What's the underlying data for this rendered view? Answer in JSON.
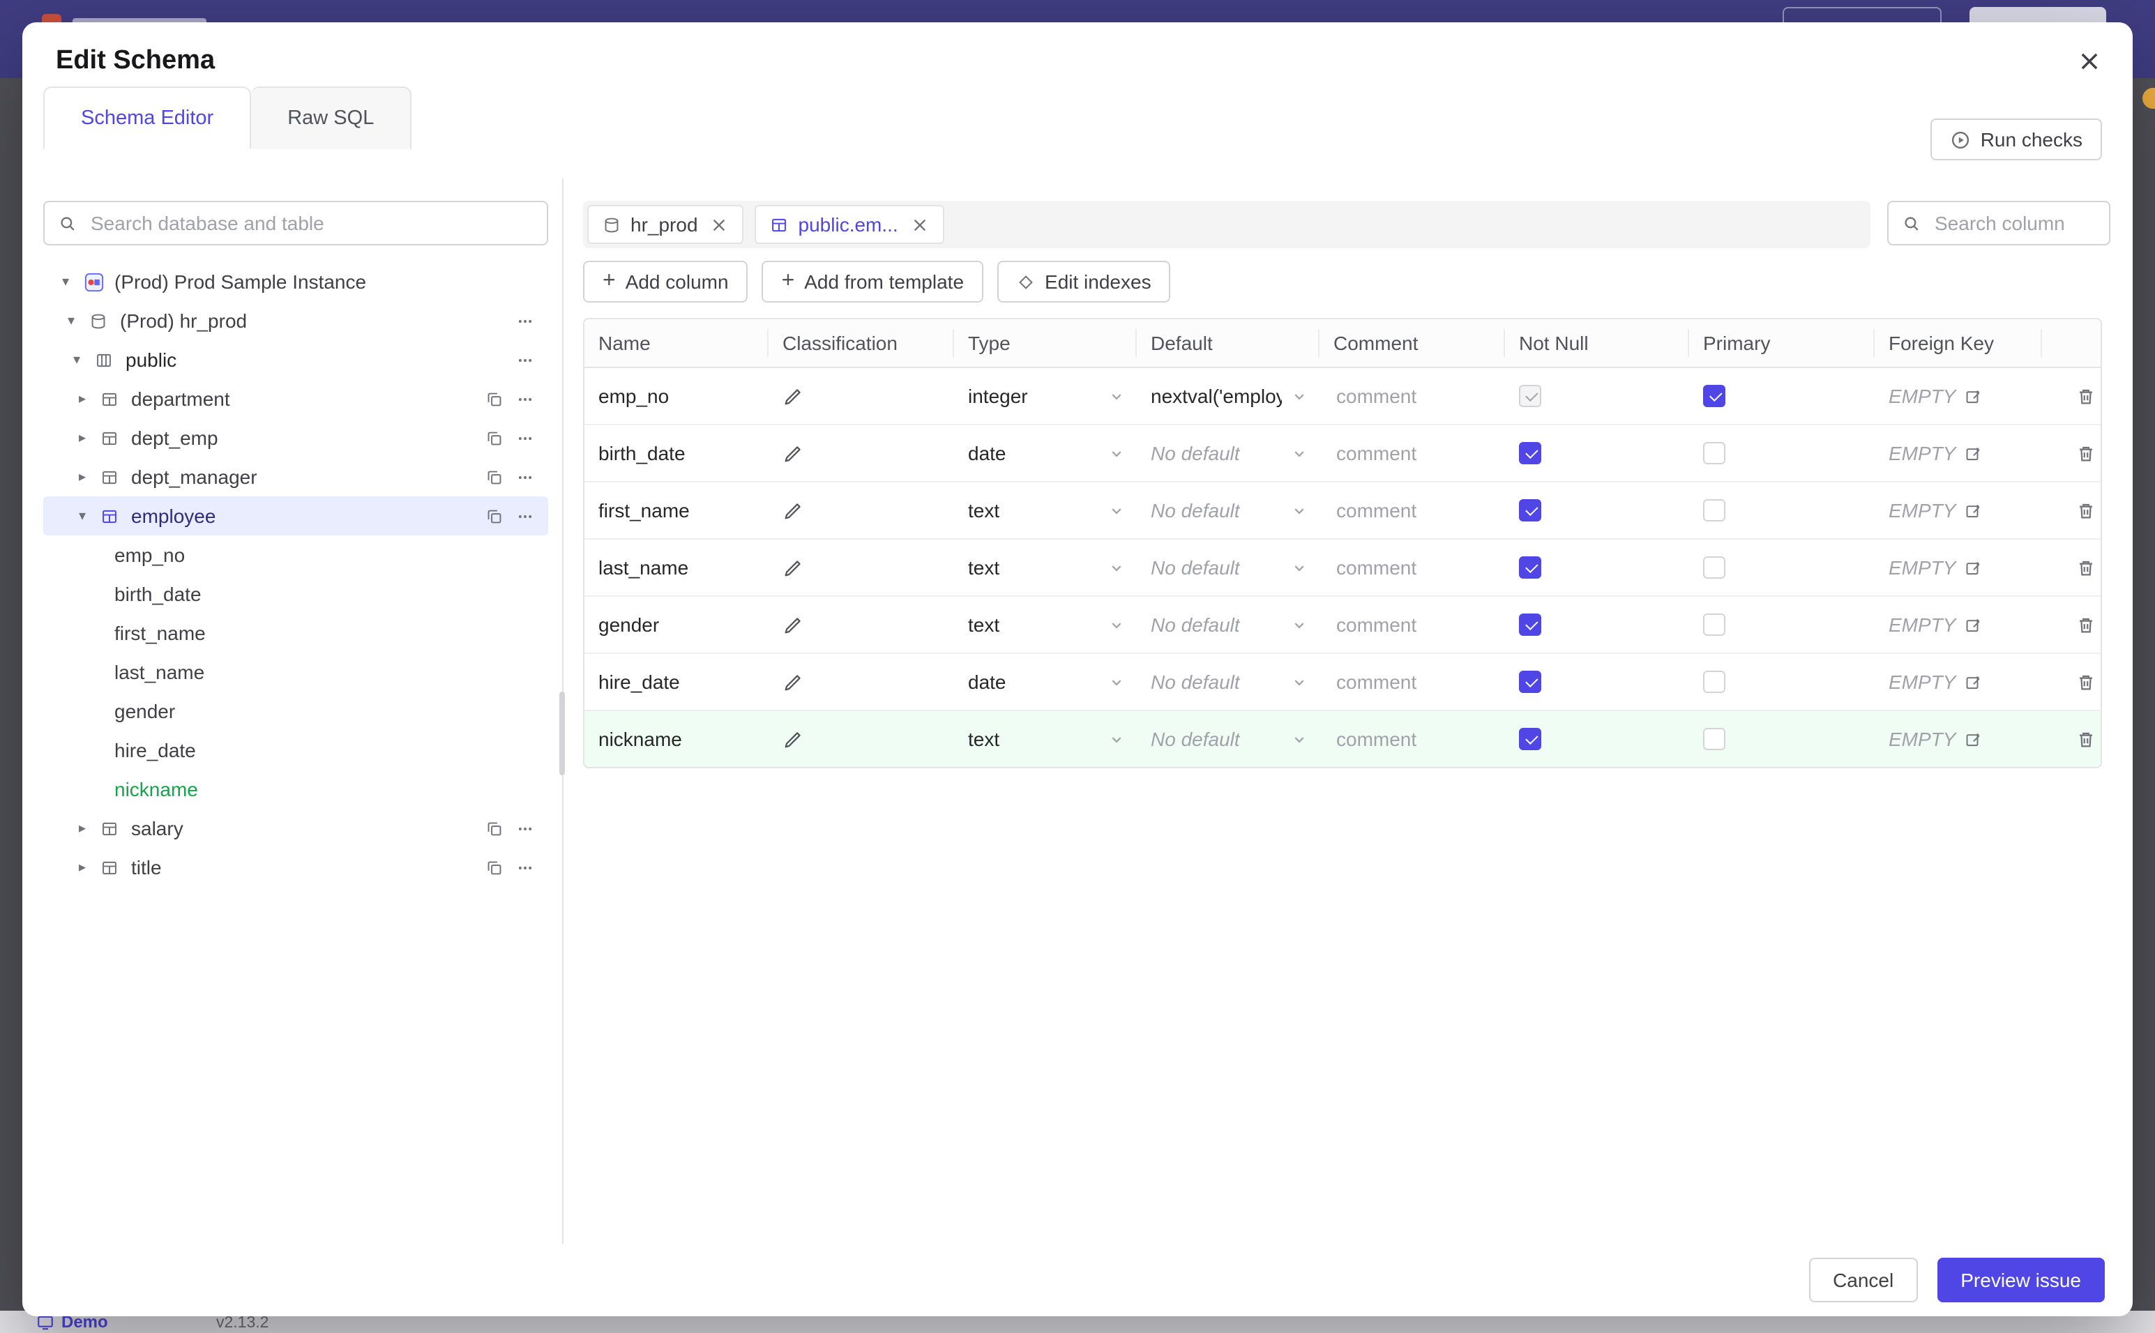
{
  "backdrop": {
    "demo_label": "Demo",
    "version": "v2.13.2"
  },
  "modal": {
    "title": "Edit Schema",
    "tabs": [
      {
        "label": "Schema Editor"
      },
      {
        "label": "Raw SQL"
      }
    ],
    "run_checks_label": "Run checks",
    "footer": {
      "cancel": "Cancel",
      "primary": "Preview issue"
    }
  },
  "sidebar": {
    "search_placeholder": "Search database and table",
    "tree": [
      {
        "label": "(Prod) Prod Sample Instance",
        "type": "instance",
        "expanded": true
      },
      {
        "label": "(Prod) hr_prod",
        "type": "database",
        "expanded": true
      },
      {
        "label": "public",
        "type": "schema",
        "expanded": true
      },
      {
        "label": "department",
        "type": "table",
        "expanded": false
      },
      {
        "label": "dept_emp",
        "type": "table",
        "expanded": false
      },
      {
        "label": "dept_manager",
        "type": "table",
        "expanded": false
      },
      {
        "label": "employee",
        "type": "table",
        "expanded": true,
        "selected": true
      },
      {
        "label": "emp_no",
        "type": "column"
      },
      {
        "label": "birth_date",
        "type": "column"
      },
      {
        "label": "first_name",
        "type": "column"
      },
      {
        "label": "last_name",
        "type": "column"
      },
      {
        "label": "gender",
        "type": "column"
      },
      {
        "label": "hire_date",
        "type": "column"
      },
      {
        "label": "nickname",
        "type": "column",
        "new": true
      },
      {
        "label": "salary",
        "type": "table",
        "expanded": false
      },
      {
        "label": "title",
        "type": "table",
        "expanded": false
      }
    ]
  },
  "main": {
    "chips": [
      {
        "label": "hr_prod",
        "type": "database"
      },
      {
        "label": "public.em...",
        "type": "table",
        "active": true
      }
    ],
    "search_placeholder": "Search column",
    "actions": {
      "add_column": "Add column",
      "add_from_template": "Add from template",
      "edit_indexes": "Edit indexes"
    },
    "table": {
      "headers": [
        "Name",
        "Classification",
        "Type",
        "Default",
        "Comment",
        "Not Null",
        "Primary",
        "Foreign Key"
      ],
      "comment_placeholder": "comment",
      "fk_value": "EMPTY",
      "rows": [
        {
          "name": "emp_no",
          "type": "integer",
          "default": "nextval('employ",
          "default_is_placeholder": false,
          "not_null": true,
          "not_null_disabled": true,
          "primary": true,
          "is_new": false
        },
        {
          "name": "birth_date",
          "type": "date",
          "default": "No default",
          "default_is_placeholder": true,
          "not_null": true,
          "not_null_disabled": false,
          "primary": false,
          "is_new": false
        },
        {
          "name": "first_name",
          "type": "text",
          "default": "No default",
          "default_is_placeholder": true,
          "not_null": true,
          "not_null_disabled": false,
          "primary": false,
          "is_new": false
        },
        {
          "name": "last_name",
          "type": "text",
          "default": "No default",
          "default_is_placeholder": true,
          "not_null": true,
          "not_null_disabled": false,
          "primary": false,
          "is_new": false
        },
        {
          "name": "gender",
          "type": "text",
          "default": "No default",
          "default_is_placeholder": true,
          "not_null": true,
          "not_null_disabled": false,
          "primary": false,
          "is_new": false
        },
        {
          "name": "hire_date",
          "type": "date",
          "default": "No default",
          "default_is_placeholder": true,
          "not_null": true,
          "not_null_disabled": false,
          "primary": false,
          "is_new": false
        },
        {
          "name": "nickname",
          "type": "text",
          "default": "No default",
          "default_is_placeholder": true,
          "not_null": true,
          "not_null_disabled": false,
          "primary": false,
          "is_new": true
        }
      ]
    }
  },
  "colors": {
    "accent": "#4f46e5",
    "new_item_green": "#16a34a",
    "topbar": "#3f3d82"
  }
}
